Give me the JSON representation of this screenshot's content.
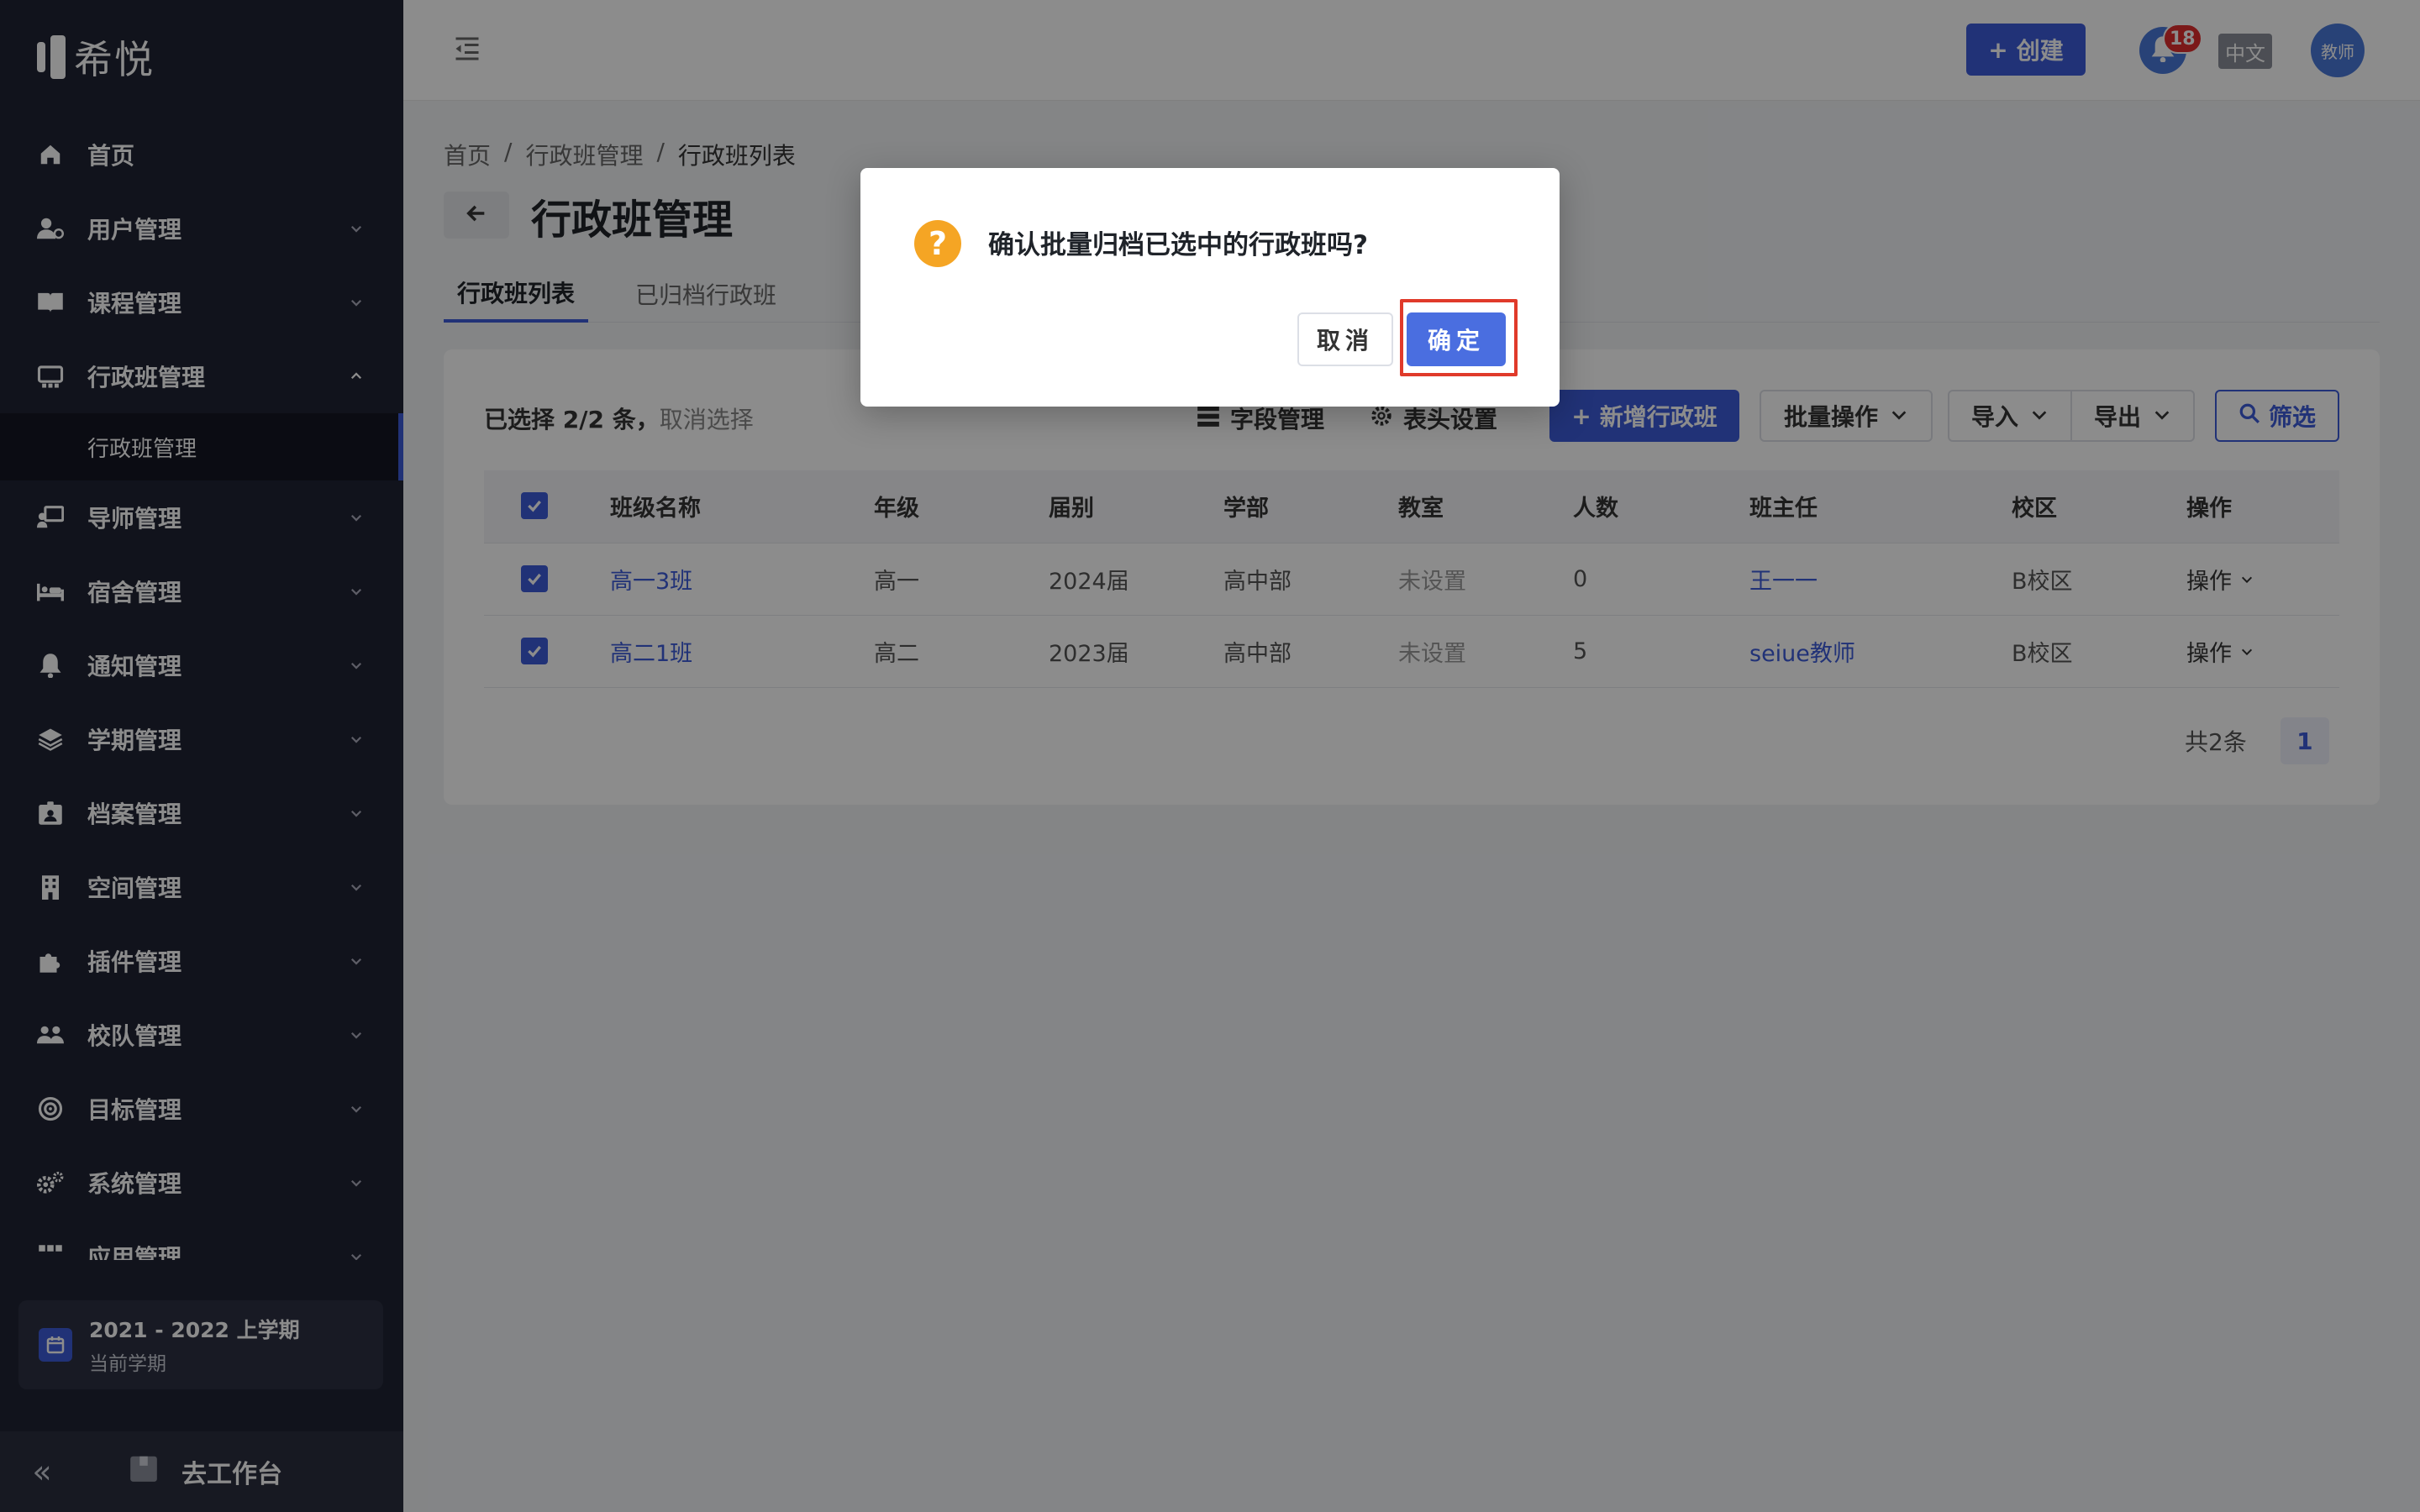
{
  "app": {
    "logo_text": "希悦"
  },
  "sidebar": {
    "items": [
      {
        "label": "首页",
        "icon": "home-icon",
        "expandable": false
      },
      {
        "label": "用户管理",
        "icon": "user-gear-icon",
        "expandable": true
      },
      {
        "label": "课程管理",
        "icon": "book-icon",
        "expandable": true
      },
      {
        "label": "行政班管理",
        "icon": "class-icon",
        "expandable": true,
        "expanded": true
      },
      {
        "label": "导师管理",
        "icon": "teacher-icon",
        "expandable": true
      },
      {
        "label": "宿舍管理",
        "icon": "bed-icon",
        "expandable": true
      },
      {
        "label": "通知管理",
        "icon": "bell-icon",
        "expandable": true
      },
      {
        "label": "学期管理",
        "icon": "layers-icon",
        "expandable": true
      },
      {
        "label": "档案管理",
        "icon": "id-card-icon",
        "expandable": true
      },
      {
        "label": "空间管理",
        "icon": "building-icon",
        "expandable": true
      },
      {
        "label": "插件管理",
        "icon": "puzzle-icon",
        "expandable": true
      },
      {
        "label": "校队管理",
        "icon": "team-icon",
        "expandable": true
      },
      {
        "label": "目标管理",
        "icon": "target-icon",
        "expandable": true
      },
      {
        "label": "系统管理",
        "icon": "gears-icon",
        "expandable": true
      },
      {
        "label": "应用管理",
        "icon": "grid-icon",
        "expandable": true
      }
    ],
    "submenu": {
      "label": "行政班管理"
    },
    "term": {
      "title": "2021 - 2022 上学期",
      "subtitle": "当前学期"
    },
    "collapse_label": "«",
    "workbench_label": "去工作台"
  },
  "header": {
    "create_label": "创建",
    "notification_count": "18",
    "lang_label": "中文",
    "avatar_label": "教师"
  },
  "breadcrumb": [
    "首页",
    "行政班管理",
    "行政班列表"
  ],
  "breadcrumb_sep": "/",
  "page_title": "行政班管理",
  "tabs": [
    "行政班列表",
    "已归档行政班"
  ],
  "toolbar": {
    "selected_text": "已选择 2/2 条，",
    "cancel_select": "取消选择",
    "field_manage": "字段管理",
    "header_settings": "表头设置",
    "add_class": "新增行政班",
    "batch_ops": "批量操作",
    "import": "导入",
    "export": "导出",
    "filter": "筛选"
  },
  "table": {
    "columns": [
      "班级名称",
      "年级",
      "届别",
      "学部",
      "教室",
      "人数",
      "班主任",
      "校区",
      "操作"
    ],
    "rows": [
      {
        "name": "高一3班",
        "grade": "高一",
        "cohort": "2024届",
        "division": "高中部",
        "room": "未设置",
        "count": "0",
        "teacher": "王一一",
        "campus": "B校区",
        "op": "操作"
      },
      {
        "name": "高二1班",
        "grade": "高二",
        "cohort": "2023届",
        "division": "高中部",
        "room": "未设置",
        "count": "5",
        "teacher": "seiue教师",
        "campus": "B校区",
        "op": "操作"
      }
    ]
  },
  "pagination": {
    "total": "共2条",
    "page": "1"
  },
  "dialog": {
    "message": "确认批量归档已选中的行政班吗?",
    "cancel": "取消",
    "confirm": "确定"
  },
  "colors": {
    "accent": "#3d5bd9",
    "sidebar": "#1f2333",
    "warning": "#f5a524",
    "highlight": "#e03a2a"
  }
}
